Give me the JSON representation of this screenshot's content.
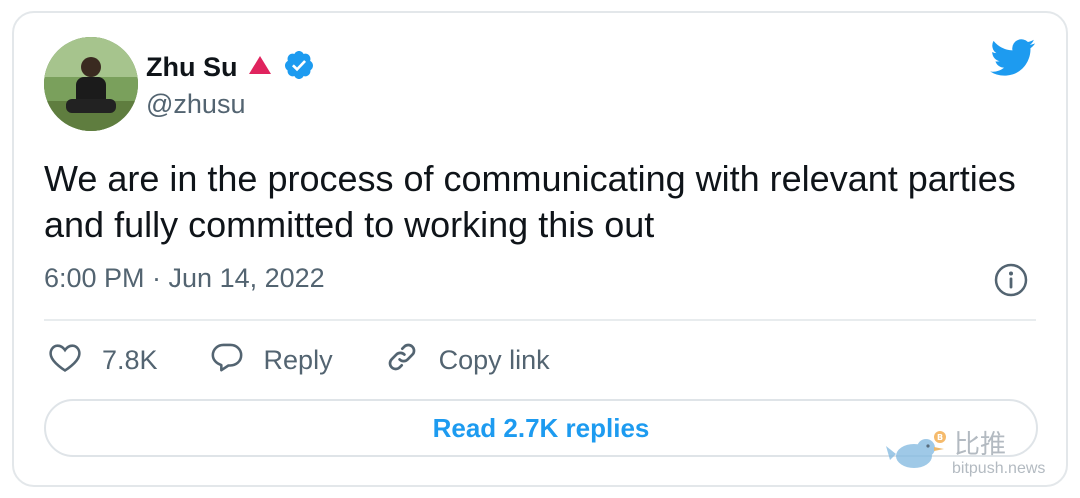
{
  "tweet": {
    "author_name": "Zhu Su",
    "handle": "@zhusu",
    "text": "We are in the process of communicating with relevant parties and fully committed to working this out",
    "timestamp": "6:00 PM · Jun 14, 2022"
  },
  "actions": {
    "like_count": "7.8K",
    "reply_label": "Reply",
    "copy_link_label": "Copy link"
  },
  "read_replies_label": "Read 2.7K replies",
  "watermark": {
    "chinese_text": "比推",
    "url_text": "bitpush.news"
  },
  "colors": {
    "twitter_blue": "#1d9bf0",
    "verified_blue": "#1d9bf0",
    "flag_red": "#e0245e",
    "text_primary": "#0f1419",
    "text_secondary": "#536471"
  },
  "icons": {
    "logo": "twitter-bird-icon",
    "verified": "verified-badge-icon",
    "flag": "red-triangle-icon",
    "info": "info-icon",
    "like": "heart-icon",
    "reply": "speech-bubble-icon",
    "copy": "link-icon"
  }
}
